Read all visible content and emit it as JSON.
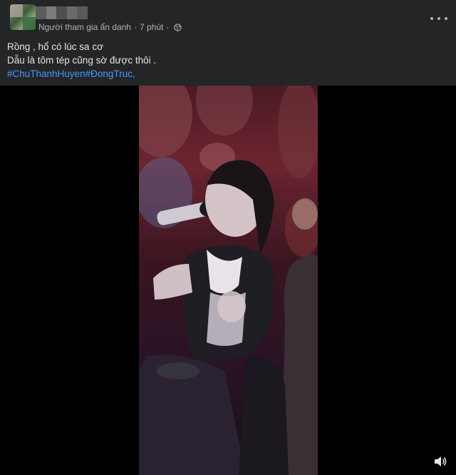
{
  "post": {
    "author_meta": "Người tham gia ẩn danh",
    "separator": "·",
    "time": "7 phút",
    "text_line_1": "Rồng , hổ có lúc sa cơ",
    "text_line_2": "Dẫu là tôm tép cũng sờ được thôi .",
    "hashtag_1": "#ChuThanhHuyen",
    "hashtag_2": "#ĐongTruc",
    "hashtag_suffix": ","
  },
  "icons": {
    "privacy": "globe-icon",
    "options": "more-options-icon",
    "volume": "speaker-icon"
  },
  "colors": {
    "background": "#242526",
    "text": "#e4e6eb",
    "meta": "#b0b3b8",
    "hashtag": "#4599ff",
    "video_bg": "#000000"
  }
}
